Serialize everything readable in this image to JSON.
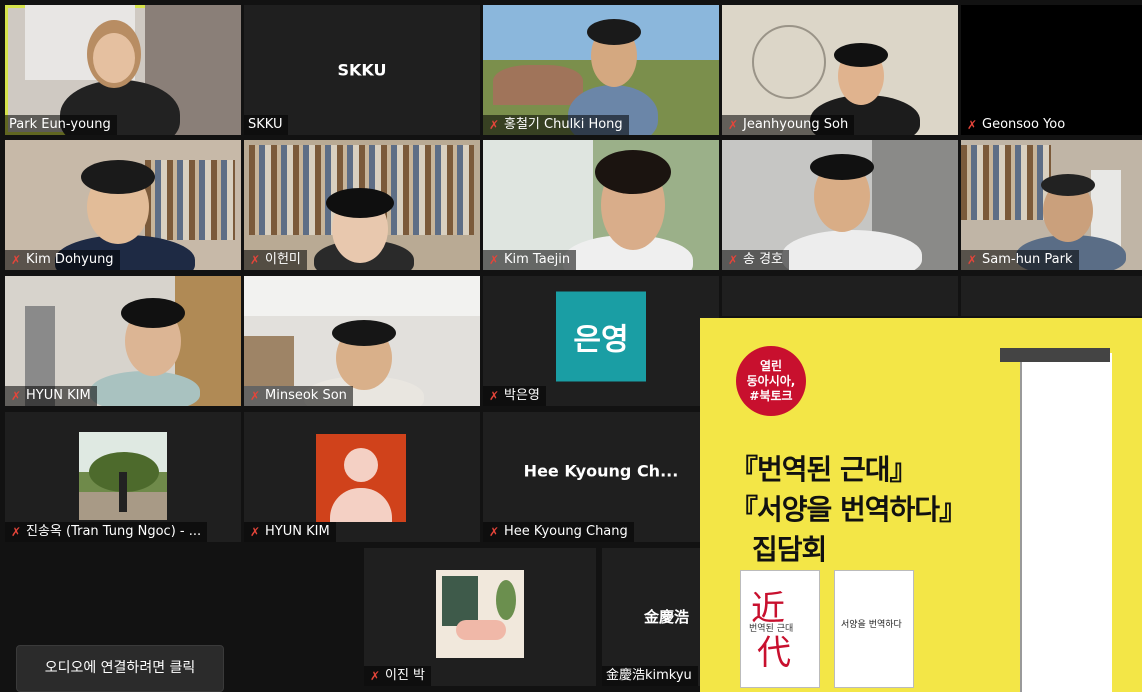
{
  "tiles": {
    "t1": {
      "name": "Park Eun-young"
    },
    "t2": {
      "name": "SKKU",
      "center": "SKKU"
    },
    "t3": {
      "name": "홍철기 Chulki Hong"
    },
    "t4": {
      "name": "Jeanhyoung Soh"
    },
    "t5": {
      "name": "Geonsoo Yoo"
    },
    "t6": {
      "name": "Kim Dohyung"
    },
    "t7": {
      "name": "이헌미"
    },
    "t8": {
      "name": "Kim Taejin"
    },
    "t9": {
      "name": "송 경호"
    },
    "t10": {
      "name": "Sam-hun Park"
    },
    "t11": {
      "name": "HYUN KIM"
    },
    "t12": {
      "name": "Minseok Son"
    },
    "t13": {
      "name": "박은영",
      "avatar_text": "은영",
      "avatar_color": "#1a9ea4"
    },
    "t14": {
      "name": "진송옥 (Tran Tung Ngoc) - ..."
    },
    "t15": {
      "name": "HYUN KIM",
      "avatar_color": "#d0421b"
    },
    "t16": {
      "name": "Hee Kyoung Chang",
      "center": "Hee Kyoung Ch..."
    },
    "t17": {
      "name": "이진 박"
    },
    "t18": {
      "name": "金慶浩kimkyu",
      "center": "金慶浩"
    }
  },
  "join_audio": "오디오에 연결하려면 클릭",
  "poster": {
    "badge": [
      "열린",
      "동아시아,",
      "#북토크"
    ],
    "line1": "『번역된 근대』",
    "line2": "『서양을 번역하다』",
    "line3": "집담회",
    "book1_title": "번역된 근대",
    "book2_title": "서양을 번역하다",
    "bg_color": "#f3e647"
  }
}
